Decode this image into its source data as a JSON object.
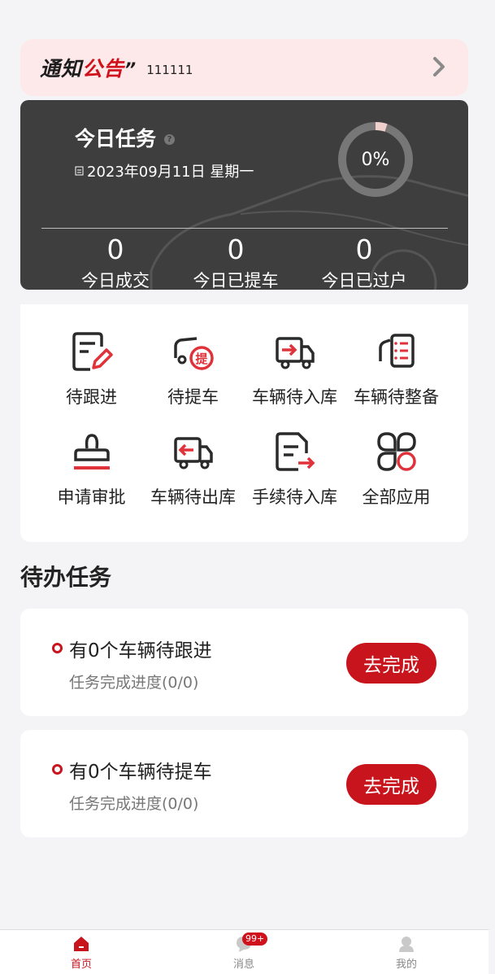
{
  "notice": {
    "logo_a": "通知",
    "logo_b": "公告",
    "logo_quote": "”",
    "text": "111111"
  },
  "task": {
    "title": "今日任务",
    "date": "2023年09月11日 星期一",
    "progress_text": "0%",
    "progress_value": 0,
    "stats": [
      {
        "value": "0",
        "label": "今日成交"
      },
      {
        "value": "0",
        "label": "今日已提车"
      },
      {
        "value": "0",
        "label": "今日已过户"
      }
    ]
  },
  "apps": [
    {
      "label": "待跟进",
      "icon": "follow-up-icon"
    },
    {
      "label": "待提车",
      "icon": "pickup-car-icon"
    },
    {
      "label": "车辆待入库",
      "icon": "truck-in-icon"
    },
    {
      "label": "车辆待整备",
      "icon": "car-checklist-icon"
    },
    {
      "label": "申请审批",
      "icon": "stamp-icon"
    },
    {
      "label": "车辆待出库",
      "icon": "truck-out-icon"
    },
    {
      "label": "手续待入库",
      "icon": "document-in-icon"
    },
    {
      "label": "全部应用",
      "icon": "all-apps-icon"
    }
  ],
  "todo_section_title": "待办任务",
  "todos": [
    {
      "title": "有0个车辆待跟进",
      "progress": "任务完成进度(0/0)",
      "button": "去完成"
    },
    {
      "title": "有0个车辆待提车",
      "progress": "任务完成进度(0/0)",
      "button": "去完成"
    }
  ],
  "tabbar": {
    "items": [
      {
        "label": "首页",
        "icon": "home-icon",
        "active": true
      },
      {
        "label": "消息",
        "icon": "message-icon",
        "badge": "99+"
      },
      {
        "label": "我的",
        "icon": "user-icon"
      }
    ]
  },
  "colors": {
    "accent": "#c8141c",
    "card_dark": "#3e3e3e",
    "notice_bg": "#fde9e9"
  }
}
